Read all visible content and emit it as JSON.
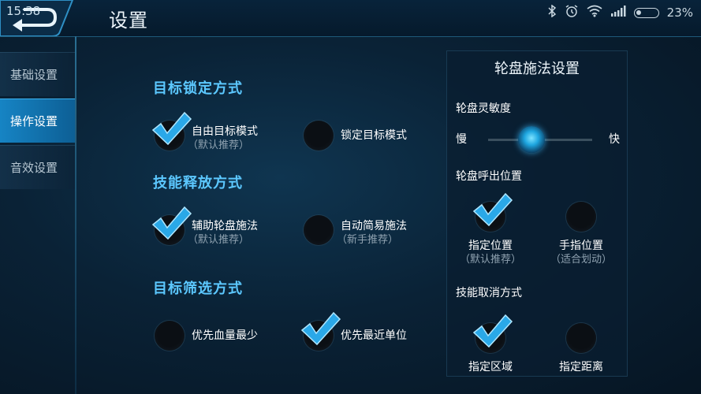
{
  "status_bar": {
    "time": "15:38",
    "battery": "23%",
    "icons": [
      "bluetooth-icon",
      "alarm-icon",
      "wifi-icon",
      "signal-icon",
      "battery-icon"
    ]
  },
  "header": {
    "title": "设置"
  },
  "sidebar": {
    "items": [
      {
        "label": "基础设置",
        "active": false
      },
      {
        "label": "操作设置",
        "active": true
      },
      {
        "label": "音效设置",
        "active": false
      }
    ]
  },
  "main": {
    "lock_mode": {
      "title": "目标锁定方式",
      "options": [
        {
          "label": "自由目标模式",
          "sub": "（默认推荐）",
          "checked": true
        },
        {
          "label": "锁定目标模式",
          "sub": "",
          "checked": false
        }
      ]
    },
    "skill_cast": {
      "title": "技能释放方式",
      "options": [
        {
          "label": "辅助轮盘施法",
          "sub": "（默认推荐）",
          "checked": true
        },
        {
          "label": "自动简易施法",
          "sub": "（新手推荐）",
          "checked": false
        }
      ]
    },
    "target_filter": {
      "title": "目标筛选方式",
      "options": [
        {
          "label": "优先血量最少",
          "sub": "",
          "checked": false
        },
        {
          "label": "优先最近单位",
          "sub": "",
          "checked": true
        }
      ]
    }
  },
  "panel": {
    "title": "轮盘施法设置",
    "sensitivity": {
      "label": "轮盘灵敏度",
      "min_label": "慢",
      "max_label": "快",
      "value": 0.42
    },
    "position": {
      "title": "轮盘呼出位置",
      "options": [
        {
          "label": "指定位置",
          "sub": "（默认推荐）",
          "checked": true
        },
        {
          "label": "手指位置",
          "sub": "（适合划动）",
          "checked": false
        }
      ]
    },
    "cancel": {
      "title": "技能取消方式",
      "options": [
        {
          "label": "指定区域",
          "checked": true
        },
        {
          "label": "指定距离",
          "checked": false
        }
      ]
    }
  },
  "colors": {
    "accent": "#5cc8ff",
    "active_tab": "#1684c4",
    "check": "#2aa8e8"
  }
}
